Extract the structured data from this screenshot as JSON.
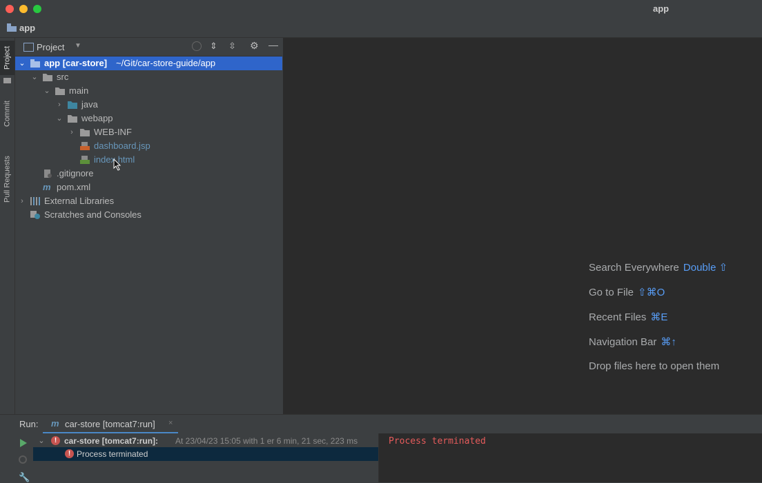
{
  "window": {
    "title": "app"
  },
  "navbar": {
    "label": "app"
  },
  "left_tabs": {
    "project": "Project",
    "commit": "Commit",
    "pull_requests": "Pull Requests"
  },
  "project_panel": {
    "header": "Project",
    "tree": [
      {
        "label": "app [car-store]",
        "suffix": "~/Git/car-store-guide/app"
      },
      {
        "label": "src"
      },
      {
        "label": "main"
      },
      {
        "label": "java"
      },
      {
        "label": "webapp"
      },
      {
        "label": "WEB-INF"
      },
      {
        "label": "dashboard.jsp"
      },
      {
        "label": "index.html"
      },
      {
        "label": ".gitignore"
      },
      {
        "label": "pom.xml"
      },
      {
        "label": "External Libraries"
      },
      {
        "label": "Scratches and Consoles"
      }
    ]
  },
  "editor": {
    "hints": [
      {
        "text": "Search Everywhere",
        "key": "Double ⇧"
      },
      {
        "text": "Go to File",
        "key": "⇧⌘O"
      },
      {
        "text": "Recent Files",
        "key": "⌘E"
      },
      {
        "text": "Navigation Bar",
        "key": "⌘↑"
      },
      {
        "text": "Drop files here to open them",
        "key": ""
      }
    ]
  },
  "run_panel": {
    "label": "Run:",
    "tab": "car-store [tomcat7:run]",
    "entry_title": "car-store [tomcat7:run]:",
    "entry_detail": "At 23/04/23 15:05 with 1 er 6 min, 21 sec, 223 ms",
    "child": "Process terminated",
    "console_text": "Process terminated"
  },
  "colors": {
    "accent": "#2f65ca",
    "link": "#589df6",
    "error": "#e55b5b",
    "folder_blue": "#3e86a0"
  }
}
